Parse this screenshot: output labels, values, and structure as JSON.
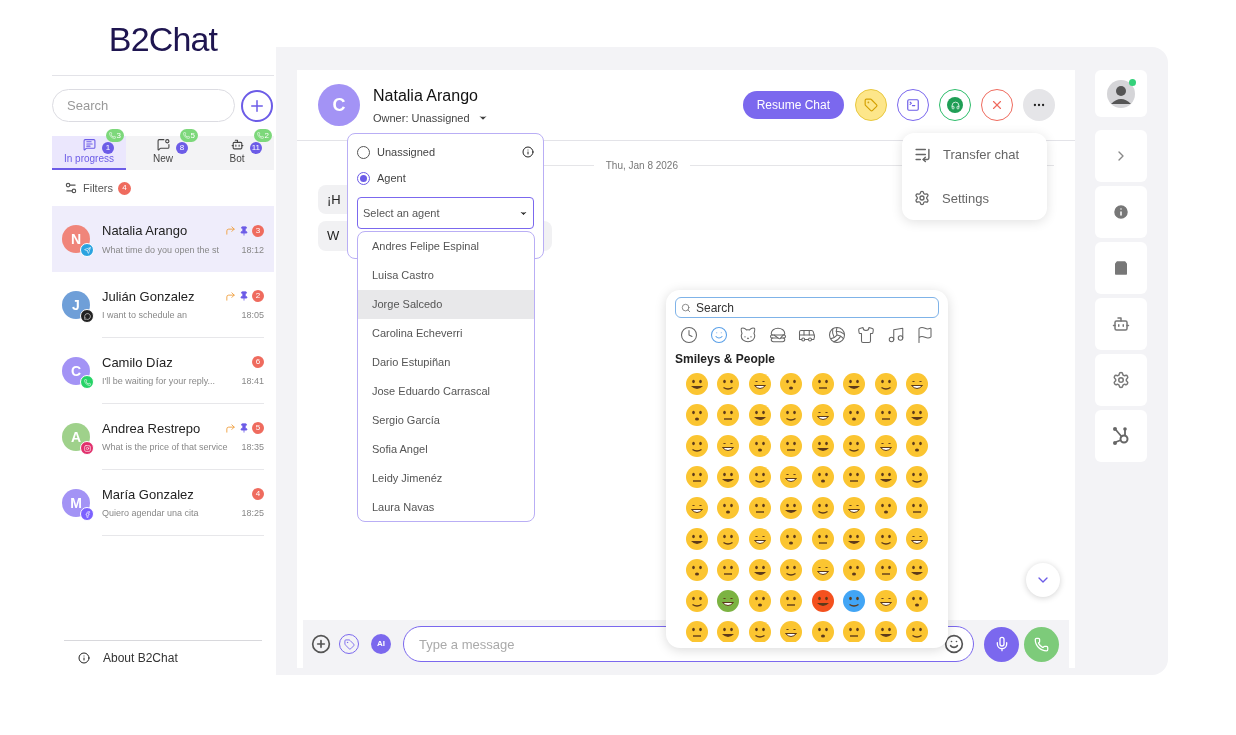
{
  "logo": "B2Chat",
  "sidebar": {
    "search": {
      "placeholder": "Search"
    },
    "tabs": [
      {
        "kind": "progress",
        "label": "In progress",
        "count": "1",
        "calls": "3",
        "selected": true
      },
      {
        "kind": "new",
        "label": "New",
        "count": "8",
        "calls": "5",
        "selected": false
      },
      {
        "kind": "bot",
        "label": "Bot",
        "count": "11",
        "calls": "2",
        "selected": false
      }
    ],
    "filters": {
      "label": "Filters",
      "count": "4"
    },
    "chats": [
      {
        "initial": "N",
        "name": "Natalia Arango",
        "preview": "What time do you open the st",
        "time": "18:12",
        "unread": "3",
        "forwarded": true,
        "pinned": true,
        "channel": {
          "kind": "telegram"
        },
        "color": "#f0857a",
        "selected": true
      },
      {
        "initial": "J",
        "name": "Julián Gonzalez",
        "preview": "I want to schedule an",
        "time": "18:05",
        "unread": "2",
        "forwarded": true,
        "pinned": true,
        "channel": {
          "kind": "webchat"
        },
        "color": "#6f9fd8",
        "selected": false
      },
      {
        "initial": "C",
        "name": "Camilo Díaz",
        "preview": "I'll be waiting for your reply...",
        "time": "18:41",
        "unread": "6",
        "forwarded": false,
        "pinned": false,
        "channel": {
          "kind": "whatsapp"
        },
        "color": "#a393f5",
        "selected": false
      },
      {
        "initial": "A",
        "name": "Andrea Restrepo",
        "preview": "What is the price of that service",
        "time": "18:35",
        "unread": "5",
        "forwarded": true,
        "pinned": true,
        "channel": {
          "kind": "instagram"
        },
        "color": "#9fd18b",
        "selected": false
      },
      {
        "initial": "M",
        "name": "María Gonzalez",
        "preview": "Quiero agendar una cita",
        "time": "18:25",
        "unread": "4",
        "forwarded": false,
        "pinned": false,
        "channel": {
          "kind": "messenger"
        },
        "color": "#a393f5",
        "selected": false
      }
    ],
    "about": "About B2Chat"
  },
  "chat": {
    "avatar": "C",
    "name": "Natalia Arango",
    "owner": "Owner: Unassigned",
    "resume_button": "Resume Chat",
    "date": "Thu, Jan 8 2026",
    "messages": [
      "¡H",
      "W"
    ],
    "composer": {
      "ai": "AI",
      "placeholder": "Type a message"
    }
  },
  "owner_popover": {
    "options": [
      {
        "label": "Unassigned",
        "selected": false
      },
      {
        "label": "Agent",
        "selected": true
      }
    ],
    "agent_select": {
      "placeholder": "Select an agent"
    },
    "agents": [
      {
        "name": "Andres Felipe Espinal",
        "selected": false
      },
      {
        "name": "Luisa Castro",
        "selected": false
      },
      {
        "name": "Jorge Salcedo",
        "selected": true
      },
      {
        "name": "Carolina Echeverri",
        "selected": false
      },
      {
        "name": "Dario Estupiñan",
        "selected": false
      },
      {
        "name": "Jose Eduardo Carrascal",
        "selected": false
      },
      {
        "name": "Sergio García",
        "selected": false
      },
      {
        "name": "Sofia Angel",
        "selected": false
      },
      {
        "name": "Leidy Jimenéz",
        "selected": false
      },
      {
        "name": "Laura Navas",
        "selected": false
      }
    ]
  },
  "more_menu": [
    {
      "kind": "transfer",
      "label": "Transfer chat"
    },
    {
      "kind": "settings",
      "label": "Settings"
    }
  ],
  "emoji_picker": {
    "search": {
      "placeholder": "Search"
    },
    "section": "Smileys & People",
    "categories": [
      {
        "kind": "recent",
        "selected": false
      },
      {
        "kind": "smileys",
        "selected": true
      },
      {
        "kind": "animals",
        "selected": false
      },
      {
        "kind": "food",
        "selected": false
      },
      {
        "kind": "travel",
        "selected": false
      },
      {
        "kind": "activity",
        "selected": false
      },
      {
        "kind": "objects",
        "selected": false
      },
      {
        "kind": "symbols",
        "selected": false
      },
      {
        "kind": "flags",
        "selected": false
      }
    ]
  },
  "profile": {
    "online": true
  }
}
